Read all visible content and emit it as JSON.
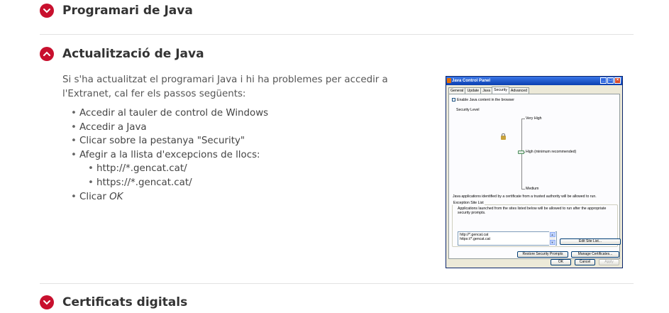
{
  "sections": [
    {
      "title": "Programari de Java",
      "expanded": false
    },
    {
      "title": "Actualització de Java",
      "expanded": true
    },
    {
      "title": "Certificats digitals",
      "expanded": false
    }
  ],
  "content": {
    "intro": "Si s'ha actualitzat el programari Java i hi ha problemes per accedir a l'Extranet, cal fer els passos següents:",
    "steps": [
      "Accedir al tauler de control de Windows",
      "Accedir a Java",
      "Clicar sobre la pestanya \"Security\"",
      "Afegir a la llista d'excepcions de llocs:"
    ],
    "sub_steps": [
      "http://*.gencat.cat/",
      "https://*.gencat.cat/"
    ],
    "last_step_prefix": "Clicar ",
    "last_step_em": "OK"
  },
  "java_panel": {
    "title": "Java Control Panel",
    "tabs": [
      "General",
      "Update",
      "Java",
      "Security",
      "Advanced"
    ],
    "active_tab": "Security",
    "enable_label": "Enable Java content in the browser",
    "security_level_label": "Security Level",
    "levels": [
      "Very High",
      "High (minimum recommended)",
      "Medium"
    ],
    "level_note": "Java applications identified by a certificate from a trusted authority will be allowed to run.",
    "exception_title": "Exception Site List",
    "exception_desc": "Applications launched from the sites listed below will be allowed to run after the appropriate security prompts.",
    "sites": [
      "http://*.gencat.cat",
      "https://*.gencat.cat"
    ],
    "edit_site_list": "Edit Site List...",
    "restore_prompts": "Restore Security Prompts",
    "manage_certs": "Manage Certificates...",
    "ok": "OK",
    "cancel": "Cancel",
    "apply": "Apply"
  },
  "colors": {
    "accent": "#c8102e",
    "text": "#333333",
    "separator": "#e3e3e3"
  }
}
